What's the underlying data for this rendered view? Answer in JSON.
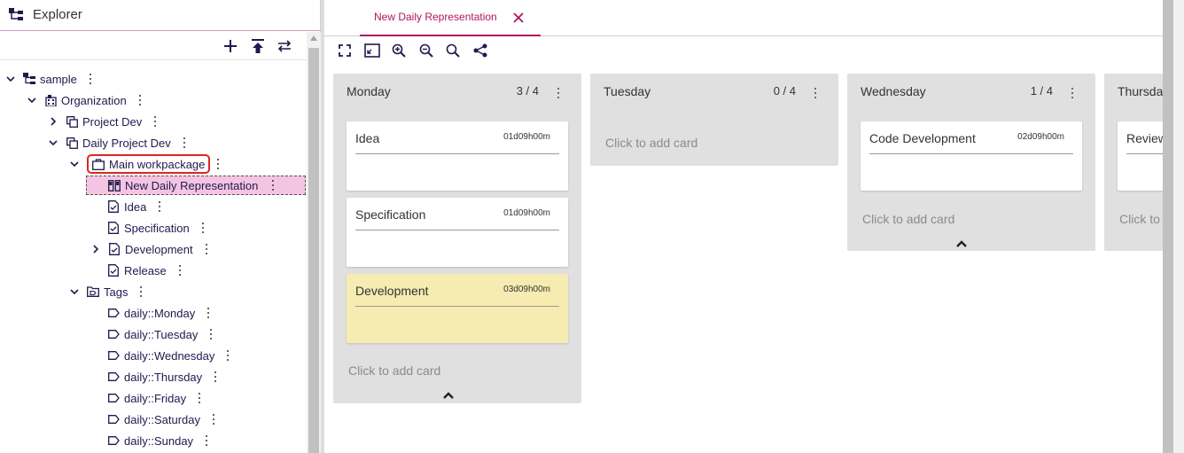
{
  "explorer": {
    "title": "Explorer",
    "toolbar": {
      "add_icon": "plus-icon",
      "collapse_icon": "upload-icon",
      "swap_icon": "swap-icon"
    },
    "tree": [
      {
        "label": "sample",
        "icon": "tree-root-icon",
        "chevron": "down"
      },
      {
        "label": "Organization",
        "icon": "building-icon",
        "chevron": "down"
      },
      {
        "label": "Project Dev",
        "icon": "copy-icon",
        "chevron": "right"
      },
      {
        "label": "Daily Project Dev",
        "icon": "copy-icon",
        "chevron": "down"
      },
      {
        "label": "Main workpackage",
        "icon": "briefcase-icon",
        "chevron": "down"
      },
      {
        "label": "New Daily Representation",
        "icon": "board-icon",
        "chevron": ""
      },
      {
        "label": "Idea",
        "icon": "doc-check-icon",
        "chevron": ""
      },
      {
        "label": "Specification",
        "icon": "doc-check-icon",
        "chevron": ""
      },
      {
        "label": "Development",
        "icon": "doc-check-icon",
        "chevron": "right"
      },
      {
        "label": "Release",
        "icon": "doc-check-icon",
        "chevron": ""
      },
      {
        "label": "Tags",
        "icon": "folder-tag-icon",
        "chevron": "down"
      },
      {
        "label": "daily::Monday",
        "icon": "tag-icon",
        "chevron": ""
      },
      {
        "label": "daily::Tuesday",
        "icon": "tag-icon",
        "chevron": ""
      },
      {
        "label": "daily::Wednesday",
        "icon": "tag-icon",
        "chevron": ""
      },
      {
        "label": "daily::Thursday",
        "icon": "tag-icon",
        "chevron": ""
      },
      {
        "label": "daily::Friday",
        "icon": "tag-icon",
        "chevron": ""
      },
      {
        "label": "daily::Saturday",
        "icon": "tag-icon",
        "chevron": ""
      },
      {
        "label": "daily::Sunday",
        "icon": "tag-icon",
        "chevron": ""
      }
    ]
  },
  "tab": {
    "label": "New Daily Representation",
    "accent": "#b0165c"
  },
  "tab_toolbar": [
    "fullscreen-icon",
    "fit-icon",
    "zoom-in-icon",
    "zoom-out-icon",
    "zoom-reset-icon",
    "share-icon"
  ],
  "board": {
    "add_card_label": "Click to add card",
    "columns": [
      {
        "title": "Monday",
        "count": "3 / 4",
        "cards": [
          {
            "title": "Idea",
            "time": "01d09h00m",
            "color": "#ffffff"
          },
          {
            "title": "Specification",
            "time": "01d09h00m",
            "color": "#ffffff"
          },
          {
            "title": "Development",
            "time": "03d09h00m",
            "color": "#f6ecb1"
          }
        ]
      },
      {
        "title": "Tuesday",
        "count": "0 / 4",
        "cards": []
      },
      {
        "title": "Wednesday",
        "count": "1 / 4",
        "cards": [
          {
            "title": "Code Development",
            "time": "02d09h00m",
            "color": "#ffffff"
          }
        ]
      },
      {
        "title": "Thursda",
        "count": "",
        "cards": [
          {
            "title": "Review",
            "time": "",
            "color": "#ffffff"
          }
        ],
        "add_card_label": "Click to"
      }
    ]
  }
}
